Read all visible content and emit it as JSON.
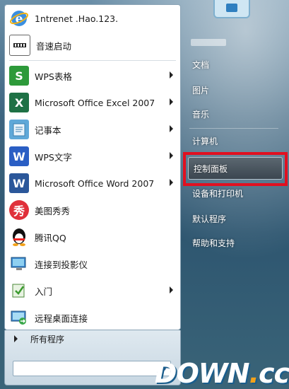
{
  "left_items": [
    {
      "label": "1ntrenet .Hao.123.",
      "icon": "ie-icon",
      "arrow": false
    },
    {
      "label": "音速启动",
      "icon": "vstart-icon",
      "arrow": false
    },
    {
      "label": "WPS表格",
      "icon": "wps-spreadsheet-icon",
      "arrow": true
    },
    {
      "label": "Microsoft Office Excel 2007",
      "icon": "excel-icon",
      "arrow": true
    },
    {
      "label": "记事本",
      "icon": "notepad-icon",
      "arrow": true
    },
    {
      "label": "WPS文字",
      "icon": "wps-writer-icon",
      "arrow": true
    },
    {
      "label": "Microsoft Office Word 2007",
      "icon": "word-icon",
      "arrow": true
    },
    {
      "label": "美图秀秀",
      "icon": "meitu-icon",
      "arrow": false
    },
    {
      "label": "腾讯QQ",
      "icon": "qq-icon",
      "arrow": false
    },
    {
      "label": "连接到投影仪",
      "icon": "projector-icon",
      "arrow": false
    },
    {
      "label": "入门",
      "icon": "getting-started-icon",
      "arrow": true
    },
    {
      "label": "远程桌面连接",
      "icon": "remote-desktop-icon",
      "arrow": false
    }
  ],
  "all_programs": "所有程序",
  "search": {
    "value": "",
    "placeholder": ""
  },
  "right_items": [
    {
      "label": "文档"
    },
    {
      "label": "图片"
    },
    {
      "label": "音乐"
    },
    {
      "label": "计算机"
    },
    {
      "label": "控制面板"
    },
    {
      "label": "设备和打印机"
    },
    {
      "label": "默认程序"
    },
    {
      "label": "帮助和支持"
    }
  ],
  "watermark": {
    "text": "DOWN",
    "dot": ".",
    "suffix": "cc"
  },
  "colors": {
    "highlight_border": "#e11020",
    "word_blue": "#2b579a",
    "excel_green": "#1e7145",
    "wps_green": "#2d9a3a",
    "wps_blue": "#2a5ec4"
  }
}
